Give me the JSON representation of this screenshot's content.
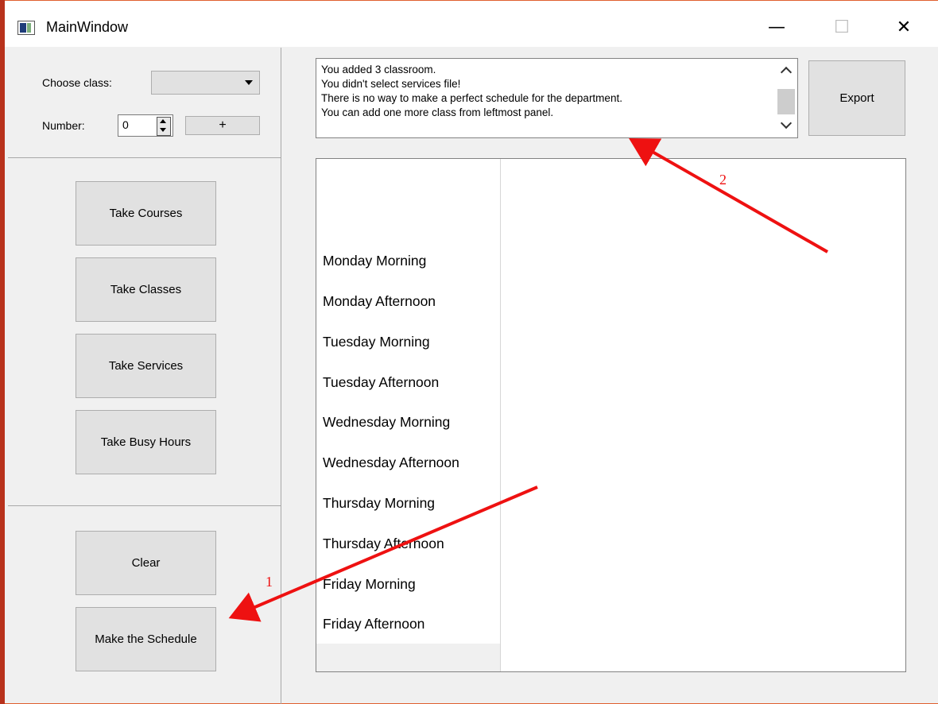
{
  "window": {
    "title": "MainWindow",
    "minimize_glyph": "—",
    "maximize_glyph": "☐",
    "close_glyph": "✕"
  },
  "controls": {
    "choose_class_label": "Choose class:",
    "choose_class_value": "",
    "number_label": "Number:",
    "number_value": "0",
    "add_button_label": "+"
  },
  "sidebar": {
    "take_courses": "Take Courses",
    "take_classes": "Take Classes",
    "take_services": "Take Services",
    "take_busy_hours": "Take Busy Hours",
    "clear": "Clear",
    "make_schedule": "Make the Schedule"
  },
  "messages": [
    "You added 3 classroom.",
    "You didn't select services file!",
    "There is no way to make a perfect schedule for the department.",
    "You can add one more class from leftmost panel."
  ],
  "export_label": "Export",
  "schedule_rows": [
    "Monday Morning",
    "Monday Afternoon",
    "Tuesday Morning",
    "Tuesday Afternoon",
    "Wednesday Morning",
    "Wednesday Afternoon",
    "Thursday Morning",
    "Thursday Afternoon",
    "Friday Morning",
    "Friday Afternoon"
  ],
  "annotations": {
    "arrow1_label": "1",
    "arrow2_label": "2",
    "arrow_color": "#ee1111"
  },
  "colors": {
    "window_bg": "#f0f0f0",
    "button_bg": "#e1e1e1",
    "border_accent": "#b8321c"
  }
}
